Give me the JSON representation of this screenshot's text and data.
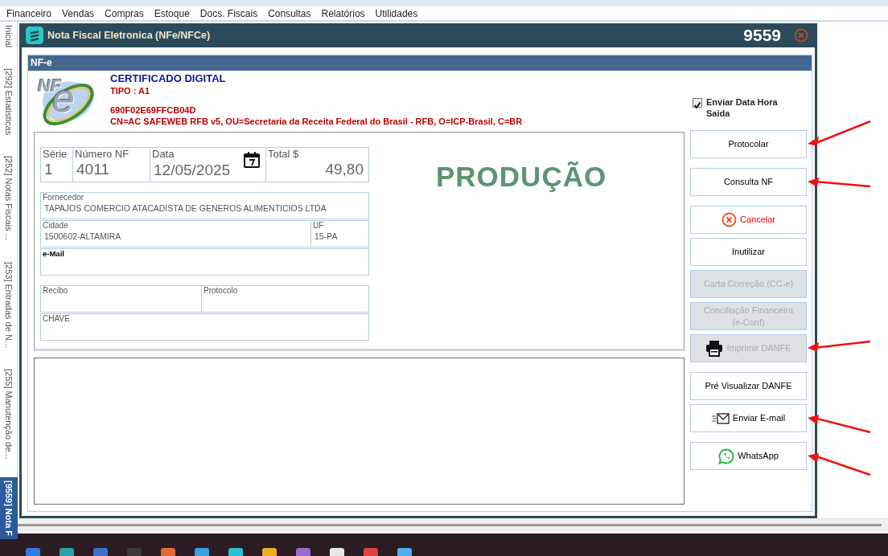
{
  "menu": [
    "Financeiro",
    "Vendas",
    "Compras",
    "Estoque",
    "Docs. Fiscais",
    "Consultas",
    "Relatórios",
    "Utilidades"
  ],
  "side_tabs": [
    {
      "label": "Inicial",
      "selected": false
    },
    {
      "label": "[292] Estatisticas",
      "selected": false
    },
    {
      "label": "[252] Notas Fiscais ...",
      "selected": false
    },
    {
      "label": "[253] Entradas de N...",
      "selected": false
    },
    {
      "label": "[255] Manutenção de...",
      "selected": false
    },
    {
      "label": "[9559] Nota F",
      "selected": true
    }
  ],
  "window": {
    "title": "Nota Fiscal Eletronica (NFe/NFCe)",
    "number": "9559"
  },
  "panel": {
    "title": "NF-e"
  },
  "certificate": {
    "logo": [
      "NF",
      "e"
    ],
    "heading": "CERTIFICADO DIGITAL",
    "type": "TIPO : A1",
    "serial": "690F02E69FFCB04D",
    "subject": "CN=AC SAFEWEB RFB v5, OU=Secretaria da Receita Federal do Brasil - RFB, O=ICP-Brasil, C=BR"
  },
  "send_datetime": {
    "label": "Enviar Data Hora Saida",
    "checked": true
  },
  "environment": "PRODUÇÃO",
  "field_groups": [
    [
      {
        "kind": "large",
        "fields": [
          {
            "kind": "text",
            "label": "Série",
            "value": "1"
          },
          {
            "kind": "text",
            "label": "Número NF",
            "value": "4011"
          },
          {
            "kind": "date",
            "label": "Data",
            "value": "12/05/2025"
          },
          {
            "kind": "amount",
            "label": "Total $",
            "value": "49,80"
          }
        ]
      }
    ],
    [
      {
        "kind": "small",
        "fields": [
          {
            "kind": "text",
            "label": "Fornecedor",
            "value": "TAPAJOS COMERCIO ATACADISTA DE GENEROS ALIMENTICIOS LTDA"
          }
        ]
      },
      {
        "kind": "small",
        "fields": [
          {
            "kind": "text",
            "label": "Cidade",
            "value": "1500602-ALTAMIRA"
          },
          {
            "kind": "text",
            "label": "UF",
            "value": "15-PA"
          }
        ]
      },
      {
        "kind": "small",
        "fields": [
          {
            "kind": "emphasis",
            "label": "e-Mail"
          }
        ]
      }
    ],
    [
      {
        "kind": "small",
        "fields": [
          {
            "kind": "text",
            "label": "Recibo"
          },
          {
            "kind": "text",
            "label": "Protocolo"
          }
        ]
      },
      {
        "kind": "small",
        "fields": [
          {
            "kind": "text",
            "label": "CHAVE"
          }
        ]
      }
    ]
  ],
  "actions": [
    {
      "kind": "plain",
      "label": "Protocolar",
      "disabled": false,
      "marked": true
    },
    {
      "kind": "plain",
      "label": "Consulta NF",
      "disabled": false,
      "marked": true
    },
    {
      "kind": "cancel",
      "label": "Cancelar",
      "disabled": false,
      "marked": false
    },
    {
      "kind": "plain",
      "label": "Inutilizar",
      "disabled": false,
      "marked": false
    },
    {
      "kind": "plain",
      "label": "Carta Correção (CC-e)",
      "disabled": true,
      "marked": false
    },
    {
      "kind": "plain",
      "label": "Conciliação Financeira (e-Conf)",
      "disabled": true,
      "marked": false
    },
    {
      "kind": "print",
      "label": "Imprimir DANFE",
      "disabled": true,
      "marked": true
    },
    {
      "kind": "plain",
      "label": "Pré Visualizar DANFE",
      "disabled": false,
      "marked": false
    },
    {
      "kind": "email",
      "label": "Enviar E-mail",
      "disabled": false,
      "marked": true
    },
    {
      "kind": "whatsapp",
      "label": "WhatsApp",
      "disabled": false,
      "marked": true
    }
  ]
}
